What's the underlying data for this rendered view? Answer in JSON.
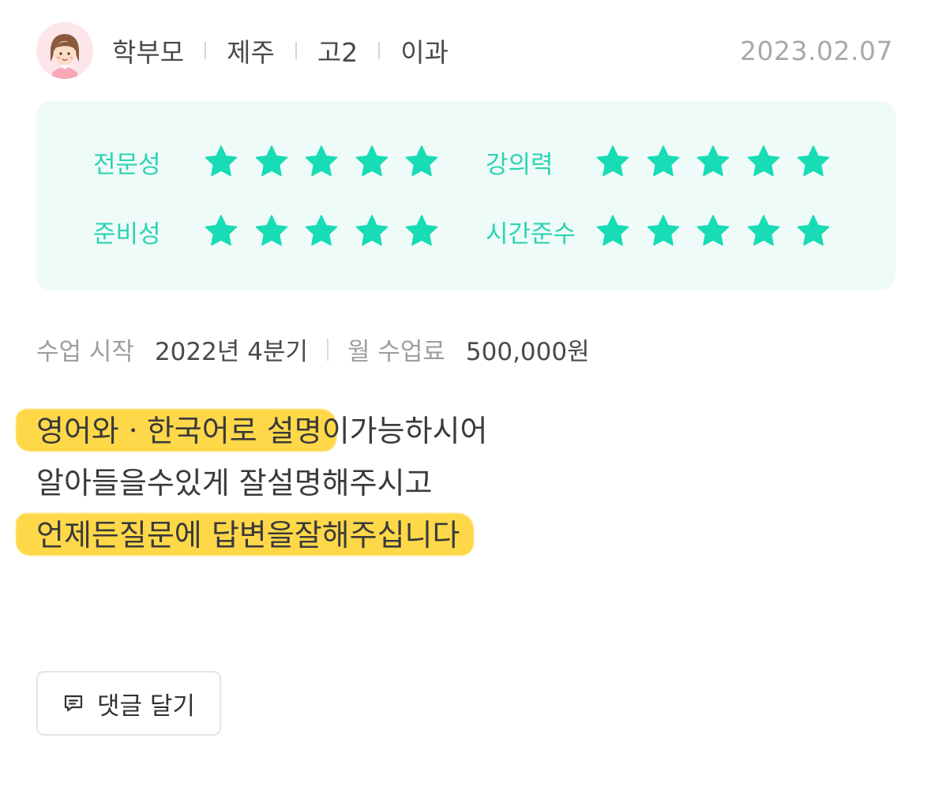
{
  "header": {
    "author_type": "학부모",
    "region": "제주",
    "grade": "고2",
    "track": "이과",
    "date": "2023.02.07"
  },
  "ratings": [
    {
      "label": "전문성",
      "score": 5,
      "max": 5
    },
    {
      "label": "강의력",
      "score": 5,
      "max": 5
    },
    {
      "label": "준비성",
      "score": 5,
      "max": 5
    },
    {
      "label": "시간준수",
      "score": 5,
      "max": 5
    }
  ],
  "class_info": {
    "start_label": "수업 시작",
    "start_value": "2022년 4분기",
    "fee_label": "월 수업료",
    "fee_value": "500,000원"
  },
  "review": {
    "line1_highlight": "영어와ㆍ한국어로 설명",
    "line1_rest": "이가능하시어",
    "line2": "알아들을수있게 잘설명해주시고",
    "line3_highlight": "언제든질문에 답변을잘해주십니다"
  },
  "comment_button": {
    "label": "댓글 달기",
    "icon": "comment-icon"
  },
  "colors": {
    "accent": "#2ed3b3",
    "star": "#17dcb5",
    "highlight": "#ffd84a",
    "rating_bg": "#effbf8"
  }
}
